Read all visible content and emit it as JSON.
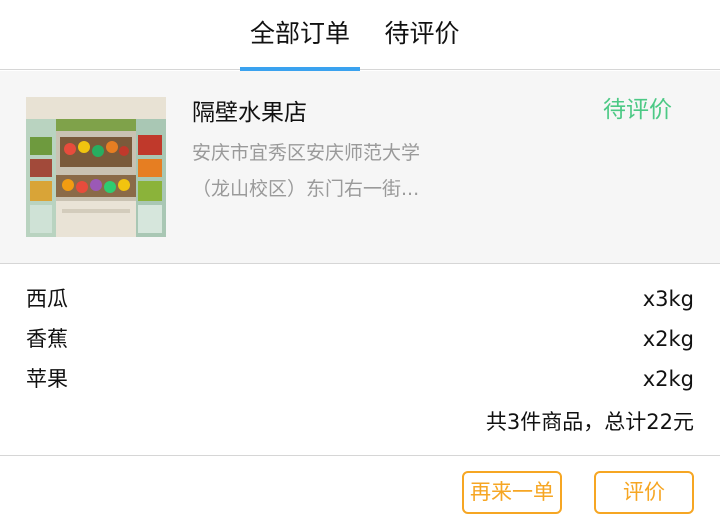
{
  "tabs": [
    {
      "label": "全部订单",
      "active": true
    },
    {
      "label": "待评价",
      "active": false
    }
  ],
  "order": {
    "store_name": "隔壁水果店",
    "status": "待评价",
    "address": "安庆市宜秀区安庆师范大学（龙山校区）东门右一街...",
    "items": [
      {
        "name": "西瓜",
        "qty": "x3kg"
      },
      {
        "name": "香蕉",
        "qty": "x2kg"
      },
      {
        "name": "苹果",
        "qty": "x2kg"
      }
    ],
    "summary": "共3件商品，总计22元",
    "buttons": {
      "reorder": "再来一单",
      "review": "评价"
    }
  },
  "colors": {
    "tab_indicator": "#3aa2ef",
    "status": "#4cc985",
    "button": "#f6a623"
  }
}
